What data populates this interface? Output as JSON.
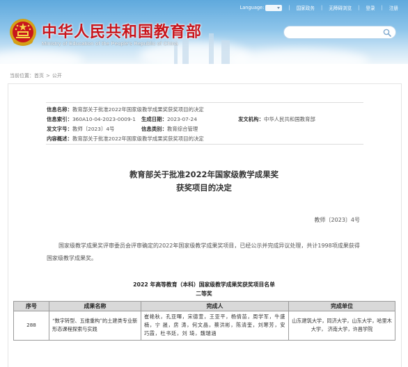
{
  "header": {
    "site_title": "中华人民共和国教育部",
    "site_subtitle": "Ministry of Education of the People's Republic of China",
    "top_links": [
      "Language:",
      "国家政务",
      "无障碍浏览",
      "登录",
      "注册"
    ],
    "search_placeholder": ""
  },
  "breadcrumb": {
    "prefix": "当前位置：",
    "items": [
      "首页",
      "公开"
    ],
    "separator": ">"
  },
  "info": {
    "name_label": "信息名称：",
    "name_value": "教育部关于批准2022年国家级教学成果奖获奖项目的决定",
    "index_label": "信息索引：",
    "index_value": "360A10-04-2023-0009-1",
    "date_label": "生成日期：",
    "date_value": "2023-07-24",
    "issuer_label": "发文机构：",
    "issuer_value": "中华人民共和国教育部",
    "doc_no_label": "发文字号：",
    "doc_no_value": "教师〔2023〕4号",
    "category_label": "信息类别：",
    "category_value": "教育综合管理",
    "summary_label": "内容概述：",
    "summary_value": "教育部关于批准2022年国家级教学成果奖获奖项目的决定"
  },
  "document": {
    "title_line1": "教育部关于批准2022年国家级教学成果奖",
    "title_line2": "获奖项目的决定",
    "doc_number": "教师〔2023〕4号",
    "paragraph": "国家级教学成果奖评审委员会评审确定的2022年国家级教学成果奖项目，已经公示并完成异议处理，共计1998项成果获得国家级教学成果奖。"
  },
  "table": {
    "title": "2022 年高等教育（本科）国家级教学成果奖获奖项目名单",
    "subtitle": "二等奖",
    "headers": [
      "序号",
      "成果名称",
      "完成人",
      "完成单位"
    ],
    "rows": [
      {
        "no": "288",
        "name": "“数字转型、五维重构”的土建类专业新形态课程探索与实践",
        "people": "崔艳秋，孔亚暉，宋德萱，王亚平，杨倩苗，周学军，牛盛楠，宁 晟，房 涛，何文晶，蔡洪彬，陈清奎，刘寒芳，安巧霞，杜书廷，刘 琦，魏瑞涵",
        "units": "山东建筑大学，同济大学，山东大学，哈里木大学， 济南大学，许昌学院"
      }
    ]
  },
  "colors": {
    "title_red": "#c8161d",
    "banner_blue": "#5fa9dd",
    "table_header_bg": "#d9d9d9"
  }
}
